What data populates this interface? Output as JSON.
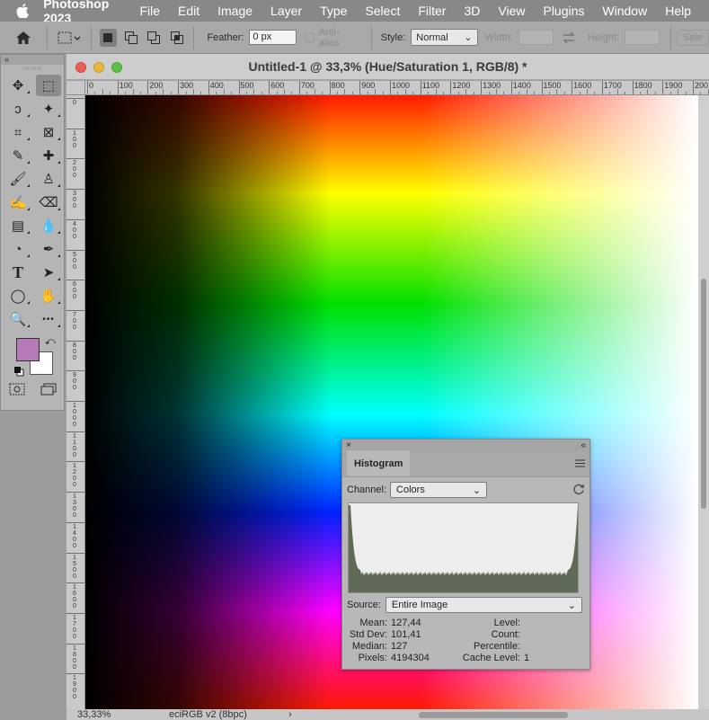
{
  "menubar": {
    "app_name": "Photoshop 2023",
    "items": [
      "File",
      "Edit",
      "Image",
      "Layer",
      "Type",
      "Select",
      "Filter",
      "3D",
      "View",
      "Plugins",
      "Window",
      "Help"
    ]
  },
  "options_bar": {
    "feather_label": "Feather:",
    "feather_value": "0 px",
    "antialias_label": "Anti-alias",
    "style_label": "Style:",
    "style_value": "Normal",
    "width_label": "Width:",
    "height_label": "Height:",
    "select_mask_label": "Sele"
  },
  "toolbox": {
    "collapse_glyph": "«",
    "foreground_color": "#b57ab8",
    "background_color": "#ffffff",
    "tools": [
      {
        "name": "move-tool-icon",
        "glyph": "✥"
      },
      {
        "name": "rectangular-marquee-icon",
        "glyph": "⬚",
        "selected": true
      },
      {
        "name": "lasso-tool-icon",
        "glyph": "ↄ"
      },
      {
        "name": "magic-wand-icon",
        "glyph": "✦"
      },
      {
        "name": "crop-tool-icon",
        "glyph": "⌗"
      },
      {
        "name": "frame-tool-icon",
        "glyph": "⊠"
      },
      {
        "name": "eyedropper-icon",
        "glyph": "✎"
      },
      {
        "name": "healing-brush-icon",
        "glyph": "✚"
      },
      {
        "name": "brush-tool-icon",
        "glyph": "🖌"
      },
      {
        "name": "clone-stamp-icon",
        "glyph": "♙"
      },
      {
        "name": "history-brush-icon",
        "glyph": "✍"
      },
      {
        "name": "eraser-tool-icon",
        "glyph": "⌫"
      },
      {
        "name": "gradient-tool-icon",
        "glyph": "▤"
      },
      {
        "name": "blur-tool-icon",
        "glyph": "💧"
      },
      {
        "name": "dodge-tool-icon",
        "glyph": "◔"
      },
      {
        "name": "pen-tool-icon",
        "glyph": "✒"
      },
      {
        "name": "type-tool-icon",
        "glyph": "T"
      },
      {
        "name": "path-selection-icon",
        "glyph": "➤"
      },
      {
        "name": "ellipse-tool-icon",
        "glyph": "◯"
      },
      {
        "name": "hand-tool-icon",
        "glyph": "✋"
      },
      {
        "name": "zoom-tool-icon",
        "glyph": "🔍"
      },
      {
        "name": "more-tools-icon",
        "glyph": "•••"
      }
    ]
  },
  "document": {
    "title": "Untitled-1 @ 33,3% (Hue/Saturation 1, RGB/8) *",
    "ruler_h_labels": [
      "0",
      "100",
      "200",
      "300",
      "400",
      "500",
      "600",
      "700",
      "800",
      "900",
      "1000",
      "1100",
      "1200",
      "1300",
      "1400",
      "1500",
      "1600",
      "1700",
      "1800",
      "1900",
      "200"
    ],
    "ruler_v_labels": [
      "0",
      "1 0 0",
      "2 0 0",
      "3 0 0",
      "4 0 0",
      "5 0 0",
      "6 0 0",
      "7 0 0",
      "8 0 0",
      "9 0 0",
      "1 0 0 0",
      "1 1 0 0",
      "1 2 0 0",
      "1 3 0 0",
      "1 4 0 0",
      "1 5 0 0",
      "1 6 0 0",
      "1 7 0 0",
      "1 8 0 0",
      "1 9 0 0"
    ],
    "zoom_value": "33,33%",
    "profile_value": "eciRGB v2 (8bpc)",
    "status_arrow": "›"
  },
  "histogram": {
    "close_glyph": "×",
    "collapse_glyph": "«",
    "tab_label": "Histogram",
    "channel_label": "Channel:",
    "channel_value": "Colors",
    "source_label": "Source:",
    "source_value": "Entire Image",
    "stats": {
      "mean_label": "Mean:",
      "mean_value": "127,44",
      "stddev_label": "Std Dev:",
      "stddev_value": "101,41",
      "median_label": "Median:",
      "median_value": "127",
      "pixels_label": "Pixels:",
      "pixels_value": "4194304",
      "level_label": "Level:",
      "level_value": "",
      "count_label": "Count:",
      "count_value": "",
      "percentile_label": "Percentile:",
      "percentile_value": "",
      "cache_label": "Cache Level:",
      "cache_value": "1"
    },
    "fill_color": "#5f6b56"
  }
}
